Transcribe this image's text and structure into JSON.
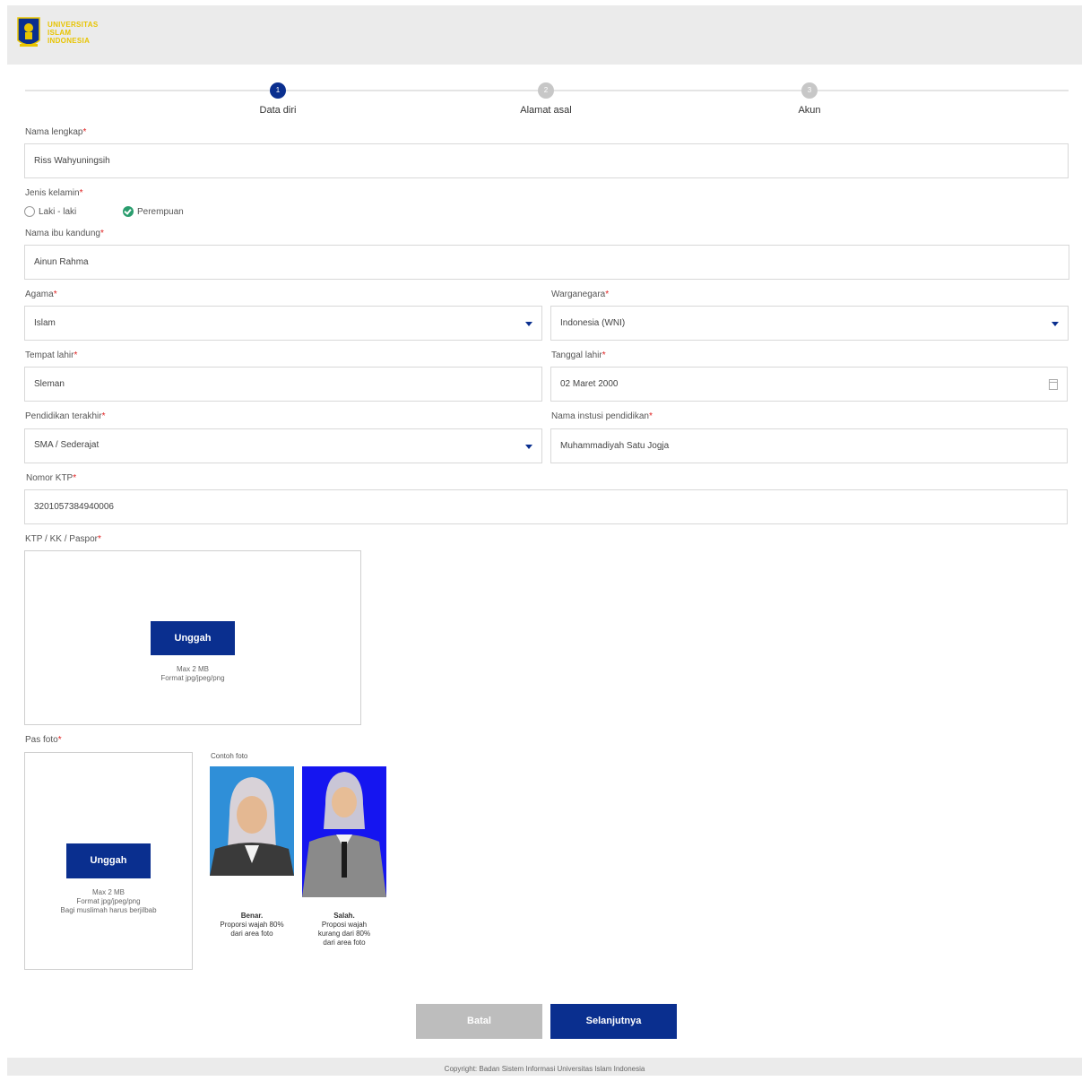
{
  "header": {
    "logo_lines": [
      "UNIVERSITAS",
      "ISLAM",
      "INDONESIA"
    ]
  },
  "steps": [
    {
      "number": "1",
      "label": "Data diri",
      "state": "active"
    },
    {
      "number": "2",
      "label": "Alamat asal",
      "state": "inactive"
    },
    {
      "number": "3",
      "label": "Akun",
      "state": "inactive"
    }
  ],
  "required_mark": "*",
  "form": {
    "full_name": {
      "label": "Nama lengkap",
      "value": "Riss Wahyuningsih"
    },
    "gender": {
      "label": "Jenis kelamin",
      "options": [
        "Laki - laki",
        "Perempuan"
      ],
      "selected": "Perempuan"
    },
    "mother_name": {
      "label": "Nama ibu kandung",
      "value": "Ainun Rahma"
    },
    "religion": {
      "label": "Agama",
      "value": "Islam"
    },
    "citizenship": {
      "label": "Warganegara",
      "value": "Indonesia (WNI)"
    },
    "birthplace": {
      "label": "Tempat lahir",
      "value": "Sleman"
    },
    "birthdate": {
      "label": "Tanggal lahir",
      "value": "02 Maret 2000"
    },
    "education": {
      "label": "Pendidikan terakhir",
      "value": "SMA / Sederajat"
    },
    "institution": {
      "label": "Nama instusi pendidikan",
      "value": "Muhammadiyah Satu Jogja"
    },
    "ktp_number": {
      "label": "Nomor KTP",
      "value": "3201057384940006"
    },
    "ktp_upload": {
      "label": "KTP / KK / Paspor",
      "button": "Unggah",
      "hint_lines": [
        "Max 2 MB",
        "Format jpg/jpeg/png"
      ]
    },
    "photo_upload": {
      "label": "Pas foto",
      "button": "Unggah",
      "hint_lines": [
        "Max 2 MB",
        "Format jpg/jpeg/png",
        "Bagi muslimah harus berjilbab"
      ]
    },
    "example": {
      "title": "Contoh foto",
      "correct": {
        "heading": "Benar.",
        "lines": [
          "Proporsi wajah 80%",
          "dari area foto"
        ],
        "bg": "#2f8fd8"
      },
      "wrong": {
        "heading": "Salah.",
        "lines": [
          "Proposi wajah",
          "kurang dari 80%",
          "dari area foto"
        ],
        "bg": "#1515f0"
      }
    }
  },
  "actions": {
    "cancel": "Batal",
    "next": "Selanjutnya"
  },
  "footer": {
    "copyright": "Copyright: Badan Sistem Informasi Universitas Islam Indonesia"
  },
  "colors": {
    "primary": "#0a2f8f",
    "required": "#e02020",
    "radio_selected": "#2a9d6e",
    "logo_gold": "#e8c400"
  }
}
